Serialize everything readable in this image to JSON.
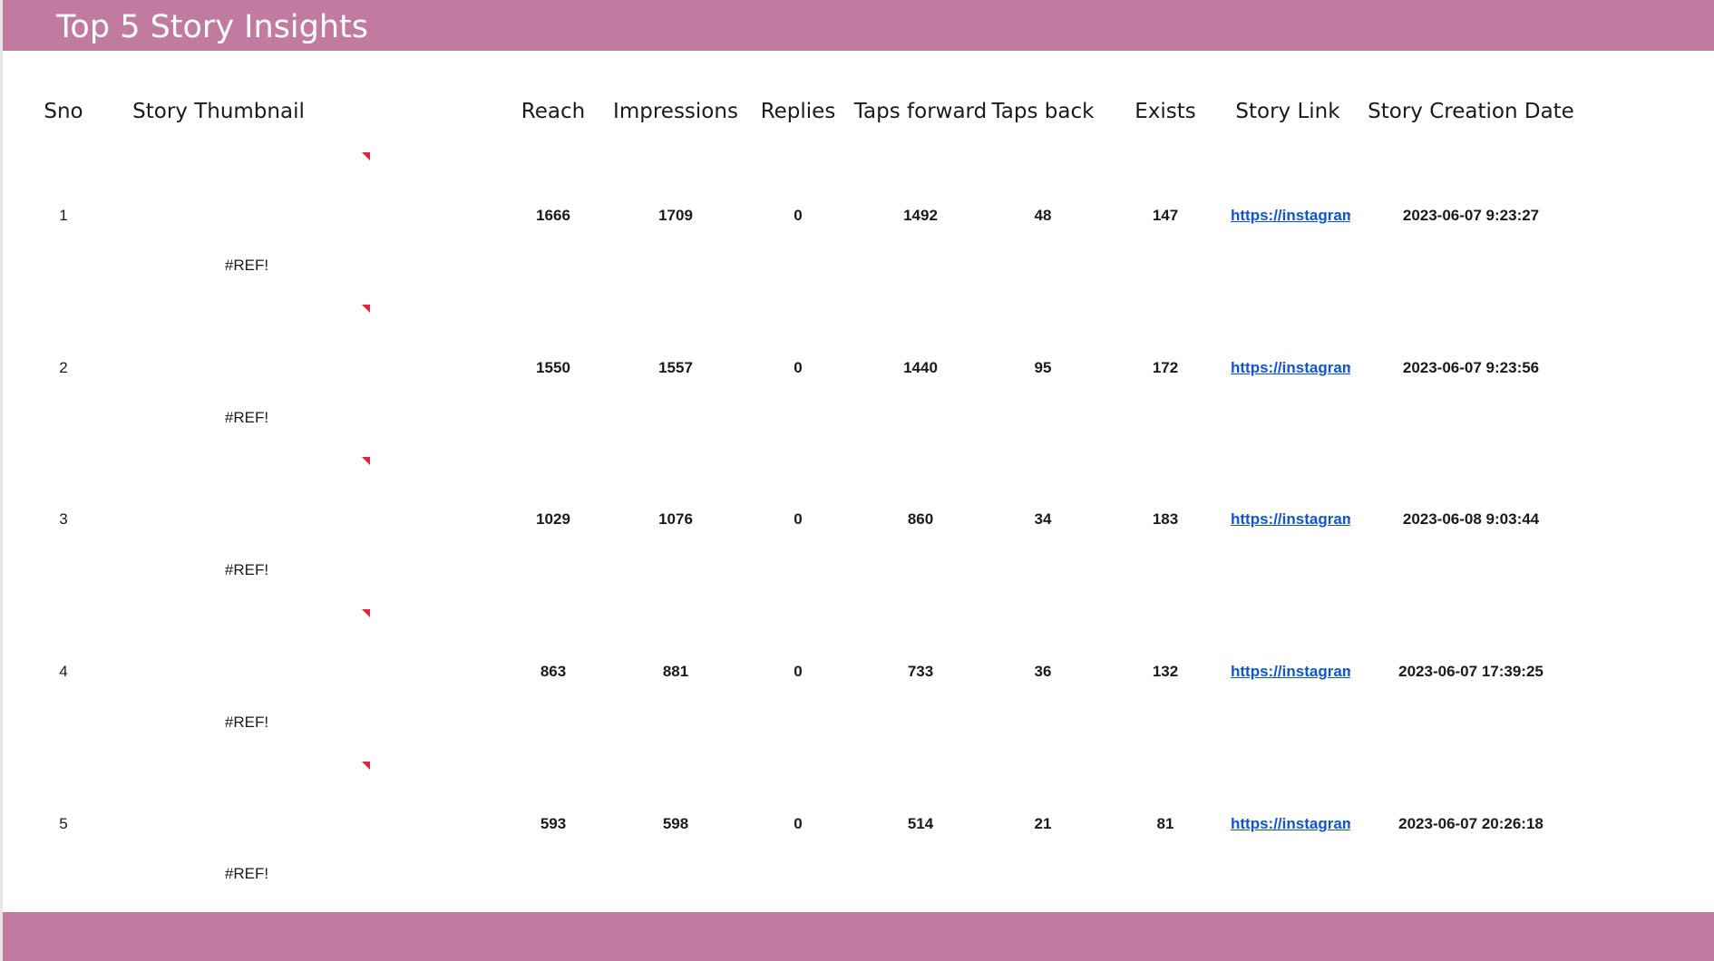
{
  "title": "Top 5 Story Insights",
  "colors": {
    "banner": "#c27ba0",
    "link": "#1155cc",
    "note_marker": "#e2243c"
  },
  "columns": {
    "sno": "Sno",
    "thumbnail": "Story Thumbnail",
    "reach": "Reach",
    "impressions": "Impressions",
    "replies": "Replies",
    "taps_forward": "Taps forward",
    "taps_back": "Taps back",
    "exists": "Exists",
    "story_link": "Story Link",
    "creation_date": "Story Creation Date"
  },
  "rows": [
    {
      "sno": "1",
      "thumbnail": "#REF!",
      "reach": "1666",
      "impressions": "1709",
      "replies": "0",
      "taps_forward": "1492",
      "taps_back": "48",
      "exists": "147",
      "story_link": "https://instagram",
      "creation_date": "2023-06-07 9:23:27"
    },
    {
      "sno": "2",
      "thumbnail": "#REF!",
      "reach": "1550",
      "impressions": "1557",
      "replies": "0",
      "taps_forward": "1440",
      "taps_back": "95",
      "exists": "172",
      "story_link": "https://instagram",
      "creation_date": "2023-06-07 9:23:56"
    },
    {
      "sno": "3",
      "thumbnail": "#REF!",
      "reach": "1029",
      "impressions": "1076",
      "replies": "0",
      "taps_forward": "860",
      "taps_back": "34",
      "exists": "183",
      "story_link": "https://instagram",
      "creation_date": "2023-06-08 9:03:44"
    },
    {
      "sno": "4",
      "thumbnail": "#REF!",
      "reach": "863",
      "impressions": "881",
      "replies": "0",
      "taps_forward": "733",
      "taps_back": "36",
      "exists": "132",
      "story_link": "https://instagram",
      "creation_date": "2023-06-07 17:39:25"
    },
    {
      "sno": "5",
      "thumbnail": "#REF!",
      "reach": "593",
      "impressions": "598",
      "replies": "0",
      "taps_forward": "514",
      "taps_back": "21",
      "exists": "81",
      "story_link": "https://instagram",
      "creation_date": "2023-06-07 20:26:18"
    }
  ]
}
